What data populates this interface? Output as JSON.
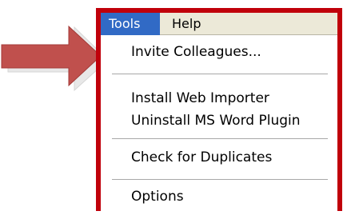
{
  "menubar": {
    "tools_label": "Tools",
    "help_label": "Help"
  },
  "tools_menu": {
    "items": [
      {
        "label": "Invite Colleagues..."
      },
      {
        "label": "Install Web Importer"
      },
      {
        "label": "Uninstall MS Word Plugin"
      },
      {
        "label": "Check for Duplicates"
      },
      {
        "label": "Options"
      }
    ]
  },
  "colors": {
    "highlight_frame": "#c0000b",
    "arrow": "#c0504d",
    "menubar_background": "#ece9d8",
    "selected_menu_background": "#316ac5"
  },
  "icons": {
    "pointer": "right-arrow-icon"
  }
}
